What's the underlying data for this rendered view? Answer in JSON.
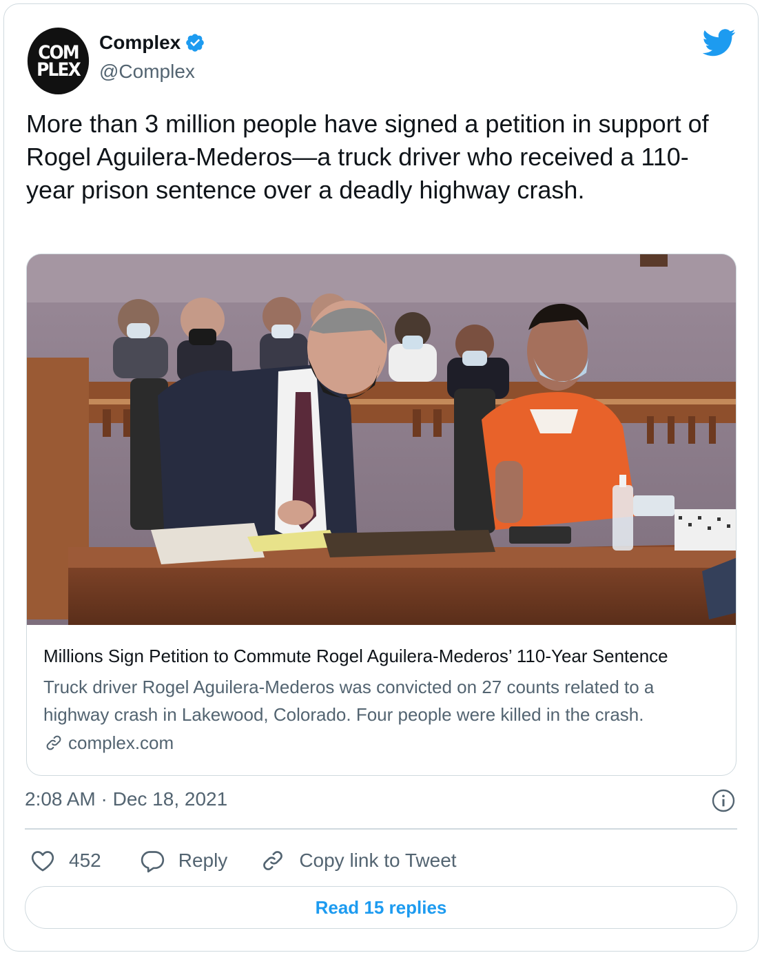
{
  "author": {
    "avatar_text_line1": "COM",
    "avatar_text_line2": "PLEX",
    "name": "Complex",
    "handle": "@Complex",
    "verified": true
  },
  "tweet": {
    "text": "More than 3 million people have signed a petition in support of Rogel Aguilera-Mederos—a truck driver who received a 110-year prison sentence over a deadly highway crash."
  },
  "link_card": {
    "image_icon": "courtroom-photo",
    "title": "Millions Sign Petition to Commute Rogel Aguilera-Mederos’ 110-Year Sentence",
    "description": "Truck driver Rogel Aguilera-Mederos was convicted on 27 counts related to a highway crash in Lakewood, Colorado. Four people were killed in the crash.",
    "domain": "complex.com"
  },
  "meta": {
    "timestamp": "2:08 AM · Dec 18, 2021"
  },
  "actions": {
    "like_count": "452",
    "reply_label": "Reply",
    "copy_link_label": "Copy link to Tweet"
  },
  "read_replies_label": "Read 15 replies",
  "colors": {
    "brand_blue": "#1d9bf0",
    "text_primary": "#0f1419",
    "text_secondary": "#536471",
    "border": "#cfd9de"
  }
}
